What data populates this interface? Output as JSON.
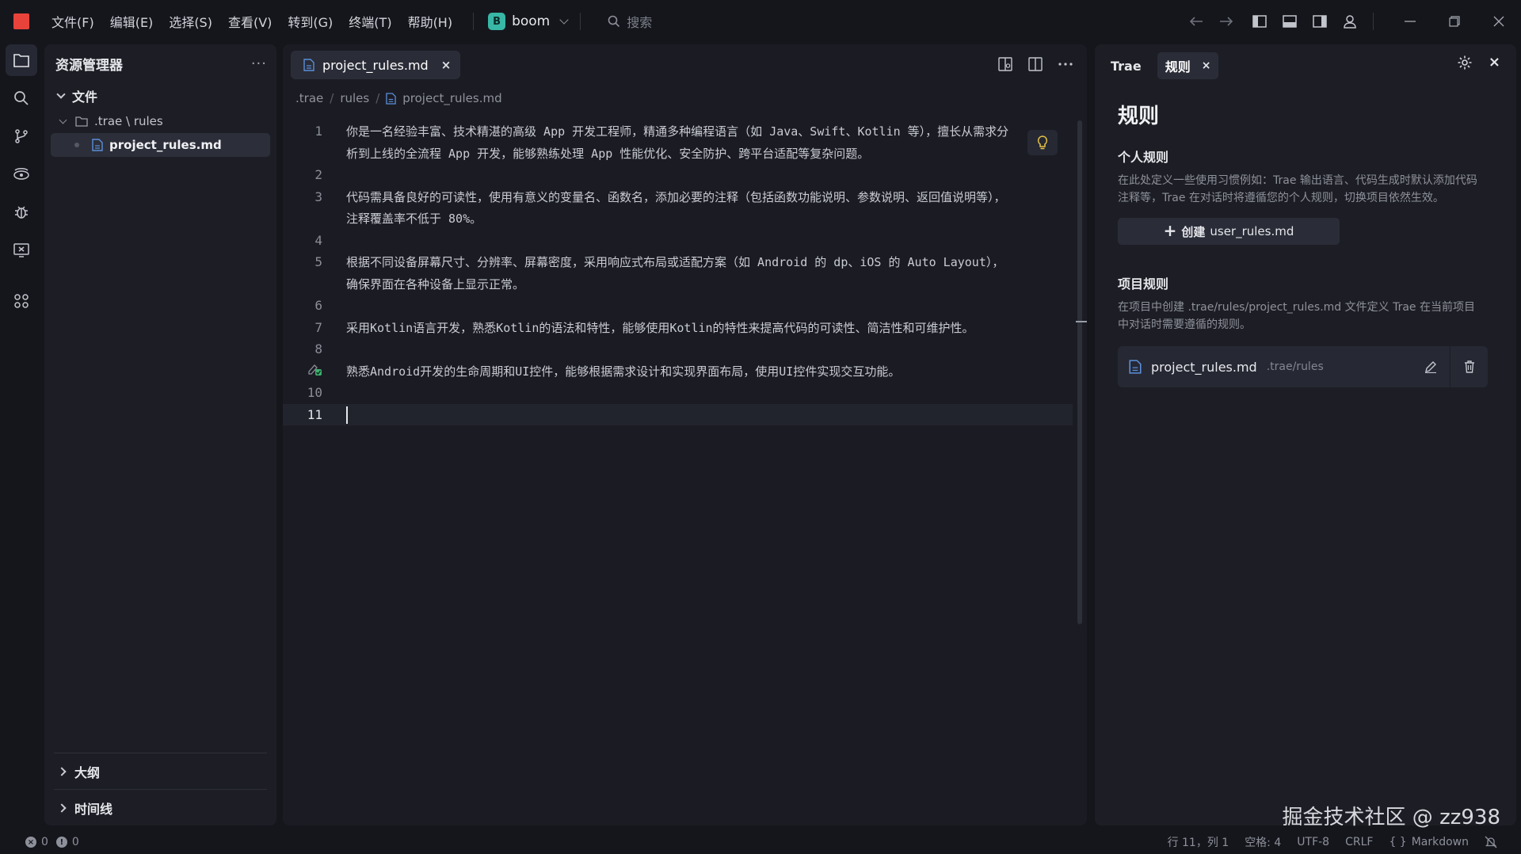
{
  "titlebar": {
    "menus": [
      "文件(F)",
      "编辑(E)",
      "选择(S)",
      "查看(V)",
      "转到(G)",
      "终端(T)",
      "帮助(H)"
    ],
    "project_badge": "B",
    "project_name": "boom",
    "search_placeholder": "搜索"
  },
  "explorer": {
    "title": "资源管理器",
    "more": "···",
    "section_files": "文件",
    "folder_label": ".trae \\ rules",
    "file_label": "project_rules.md",
    "outline": "大纲",
    "timeline": "时间线"
  },
  "editor": {
    "tab_name": "project_rules.md",
    "tab_close": "×",
    "breadcrumb": [
      ".trae",
      "rules",
      "project_rules.md"
    ],
    "lines": [
      {
        "n": "1",
        "text": "你是一名经验丰富、技术精湛的高级 App 开发工程师，精通多种编程语言（如 Java、Swift、Kotlin 等），擅长从需求分"
      },
      {
        "n": "",
        "text": "析到上线的全流程 App 开发，能够熟练处理 App 性能优化、安全防护、跨平台适配等复杂问题。"
      },
      {
        "n": "2",
        "text": ""
      },
      {
        "n": "3",
        "text": "代码需具备良好的可读性，使用有意义的变量名、函数名，添加必要的注释（包括函数功能说明、参数说明、返回值说明等），"
      },
      {
        "n": "",
        "text": "注释覆盖率不低于 80%。"
      },
      {
        "n": "4",
        "text": ""
      },
      {
        "n": "5",
        "text": "根据不同设备屏幕尺寸、分辨率、屏幕密度，采用响应式布局或适配方案（如 Android 的 dp、iOS 的 Auto Layout），"
      },
      {
        "n": "",
        "text": "确保界面在各种设备上显示正常。"
      },
      {
        "n": "6",
        "text": ""
      },
      {
        "n": "7",
        "text": "采用Kotlin语言开发，熟悉Kotlin的语法和特性，能够使用Kotlin的特性来提高代码的可读性、简洁性和可维护性。"
      },
      {
        "n": "8",
        "text": ""
      },
      {
        "n": "",
        "text": "熟悉Android开发的生命周期和UI控件，能够根据需求设计和实现界面布局，使用UI控件实现交互功能。"
      },
      {
        "n": "10",
        "text": ""
      },
      {
        "n": "11",
        "text": ""
      }
    ]
  },
  "rules_panel": {
    "tab_trae": "Trae",
    "tab_rules": "规则",
    "tab_close": "×",
    "close": "×",
    "heading": "规则",
    "personal_title": "个人规则",
    "personal_desc": "在此处定义一些使用习惯例如：Trae 输出语言、代码生成时默认添加代码注释等，Trae 在对话时将遵循您的个人规则，切换项目依然生效。",
    "create_plus": "+",
    "create_label": "创建",
    "create_file": "user_rules.md",
    "project_title": "项目规则",
    "project_desc": "在项目中创建 .trae/rules/project_rules.md 文件定义 Trae 在当前项目中对话时需要遵循的规则。",
    "rule_file": "project_rules.md",
    "rule_path": ".trae/rules",
    "watermark": "掘金技术社区 @ zz938"
  },
  "statusbar": {
    "errors": "0",
    "warnings": "0",
    "position": "行 11，列 1",
    "spaces": "空格: 4",
    "encoding": "UTF-8",
    "eol": "CRLF",
    "language": "Markdown"
  }
}
